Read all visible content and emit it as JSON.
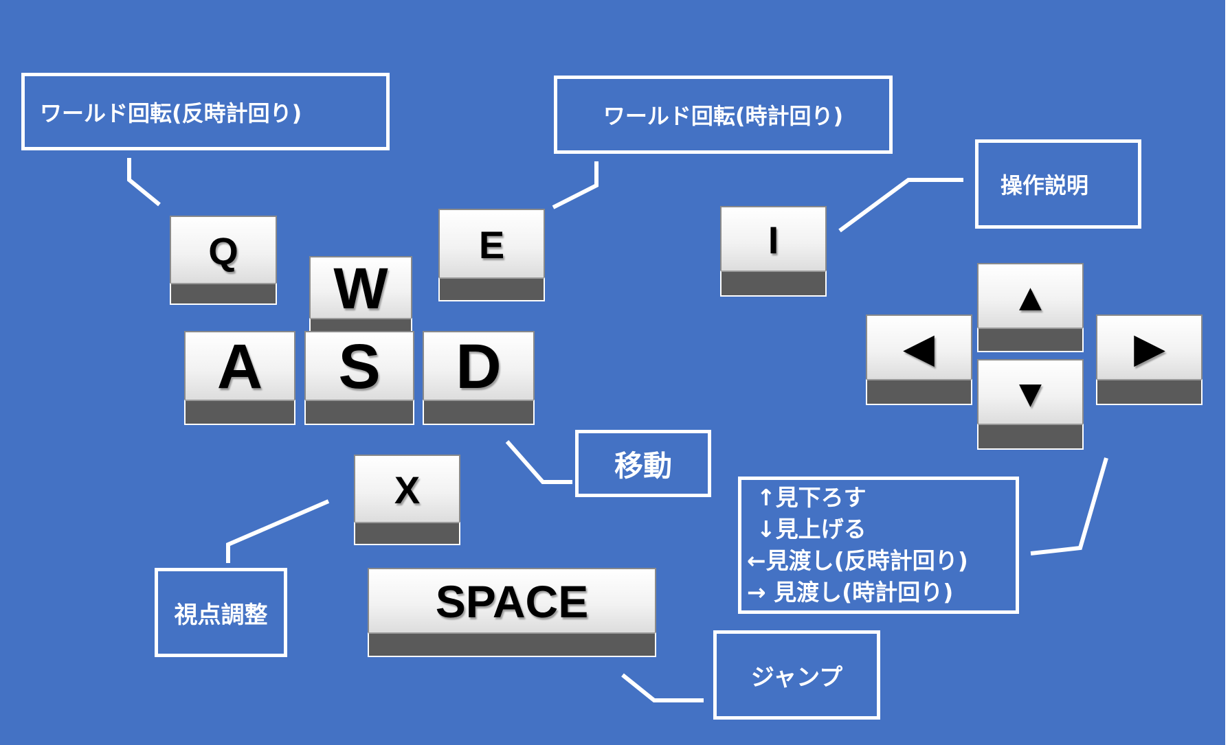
{
  "keys": {
    "q": "Q",
    "w": "W",
    "e": "E",
    "a": "A",
    "s": "S",
    "d": "D",
    "x": "X",
    "space": "SPACE",
    "i": "I",
    "up": "▲",
    "left": "◀",
    "down": "▼",
    "right": "▶"
  },
  "labels": {
    "rotate_ccw": "ワールド回転(反時計回り)",
    "rotate_cw": "ワールド回転(時計回り)",
    "instructions": "操作説明",
    "move": "移動",
    "view_adjust": "視点調整",
    "jump": "ジャンプ",
    "arrows": [
      "↑見下ろす",
      "↓見上げる",
      "←見渡し(反時計回り)",
      "→ 見渡し(時計回り)"
    ]
  },
  "colors": {
    "background": "#4472c4",
    "box_border": "#ffffff",
    "key_face": "#f2f2f2",
    "key_side": "#5a5a5a"
  }
}
